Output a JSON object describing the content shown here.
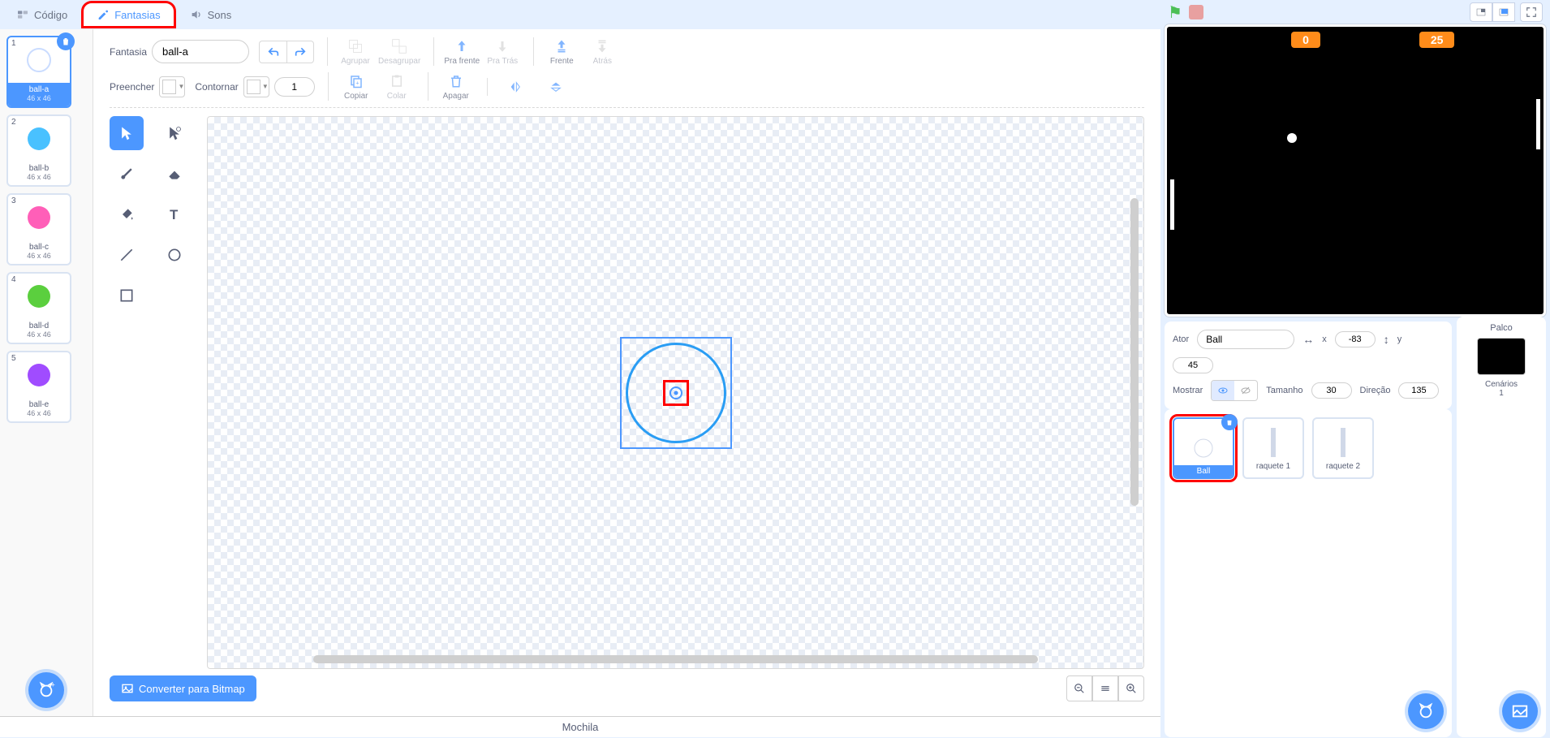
{
  "tabs": {
    "code": "Código",
    "costumes": "Fantasias",
    "sounds": "Sons"
  },
  "costumes": [
    {
      "num": "1",
      "name": "ball-a",
      "dims": "46 x 46",
      "color": "#ffffff",
      "stroke": "#3aa0ff",
      "selected": true
    },
    {
      "num": "2",
      "name": "ball-b",
      "dims": "46 x 46",
      "color": "#49c1ff"
    },
    {
      "num": "3",
      "name": "ball-c",
      "dims": "46 x 46",
      "color": "#ff5fb8"
    },
    {
      "num": "4",
      "name": "ball-d",
      "dims": "46 x 46",
      "color": "#5bcf3e"
    },
    {
      "num": "5",
      "name": "ball-e",
      "dims": "46 x 46",
      "color": "#a04cff"
    }
  ],
  "paint": {
    "costume_label": "Fantasia",
    "costume_name": "ball-a",
    "group": "Agrupar",
    "ungroup": "Desagrupar",
    "forward": "Pra frente",
    "backward": "Pra Trás",
    "front": "Frente",
    "back": "Atrás",
    "fill": "Preencher",
    "outline": "Contornar",
    "outline_width": "1",
    "copy": "Copiar",
    "paste": "Colar",
    "delete": "Apagar",
    "convert": "Converter para Bitmap"
  },
  "backpack": "Mochila",
  "stage_vars": {
    "left_score": "0",
    "right_score": "25"
  },
  "sprite_info": {
    "actor_label": "Ator",
    "actor_name": "Ball",
    "x_label": "x",
    "x_value": "-83",
    "y_label": "y",
    "y_value": "45",
    "show_label": "Mostrar",
    "size_label": "Tamanho",
    "size_value": "30",
    "direction_label": "Direção",
    "direction_value": "135"
  },
  "sprites": [
    {
      "name": "Ball",
      "selected": true
    },
    {
      "name": "raquete 1"
    },
    {
      "name": "raquete 2"
    }
  ],
  "stage_panel": {
    "title": "Palco",
    "backdrops_label": "Cenários",
    "backdrops_count": "1"
  }
}
